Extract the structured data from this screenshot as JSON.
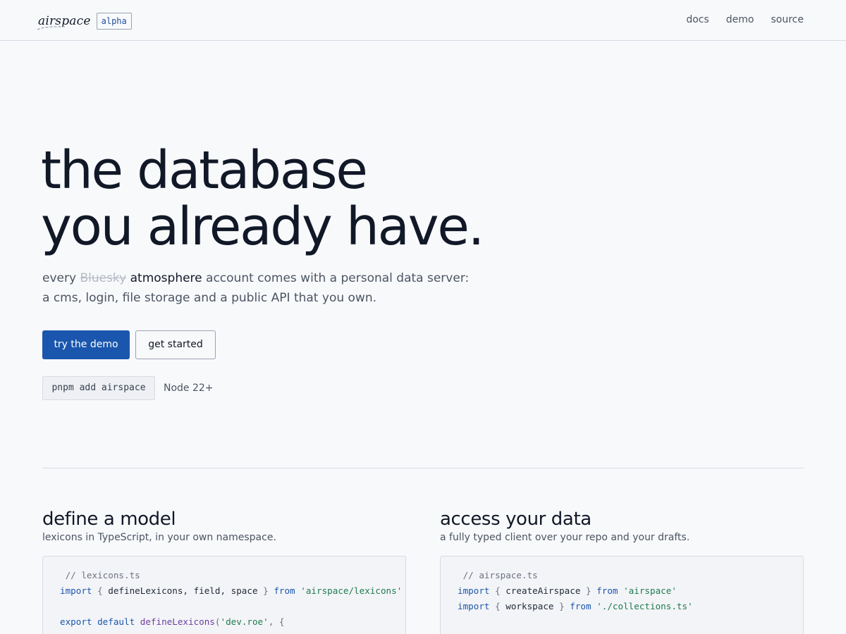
{
  "header": {
    "logo_text": "airspace",
    "badge": "alpha",
    "nav": [
      {
        "label": "docs"
      },
      {
        "label": "demo"
      },
      {
        "label": "source"
      }
    ]
  },
  "hero": {
    "title_line1": "the database",
    "title_line2": "you already have.",
    "lede_prefix": "every ",
    "lede_struck": "Bluesky",
    "lede_highlight": "atmosphere",
    "lede_suffix": " account comes with a personal data server: a cms, login, file storage and a public API that you own.",
    "primary_button": "try the demo",
    "secondary_button": "get started",
    "install_command": "pnpm add airspace",
    "node_requirement": "Node 22+"
  },
  "features": {
    "left": {
      "title": "define a model",
      "subtitle": "lexicons in TypeScript, in your own namespace.",
      "code": {
        "l1": "// lexicons.ts",
        "l2_kw": "import",
        "l2_a": " { ",
        "l2_b": "defineLexicons, field, space",
        "l2_c": " } ",
        "l2_kw2": "from",
        "l2_str": " 'airspace/lexicons'",
        "l4_kw": "export default",
        "l4_fn": " defineLexicons",
        "l4_a": "(",
        "l4_str": "'dev.roe'",
        "l4_b": ", {"
      }
    },
    "right": {
      "title": "access your data",
      "subtitle": "a fully typed client over your repo and your drafts.",
      "code": {
        "l1": "// airspace.ts",
        "l2_kw": "import",
        "l2_a": " { ",
        "l2_b": "createAirspace",
        "l2_c": " } ",
        "l2_kw2": "from",
        "l2_str": " 'airspace'",
        "l3_kw": "import",
        "l3_a": " { ",
        "l3_b": "workspace",
        "l3_c": " } ",
        "l3_kw2": "from",
        "l3_str": " './collections.ts'"
      }
    }
  },
  "colors": {
    "background": "#f8f9fb",
    "accent": "#1a56ad",
    "text": "#111827",
    "muted": "#4b5563",
    "border": "#d7dbe3"
  }
}
